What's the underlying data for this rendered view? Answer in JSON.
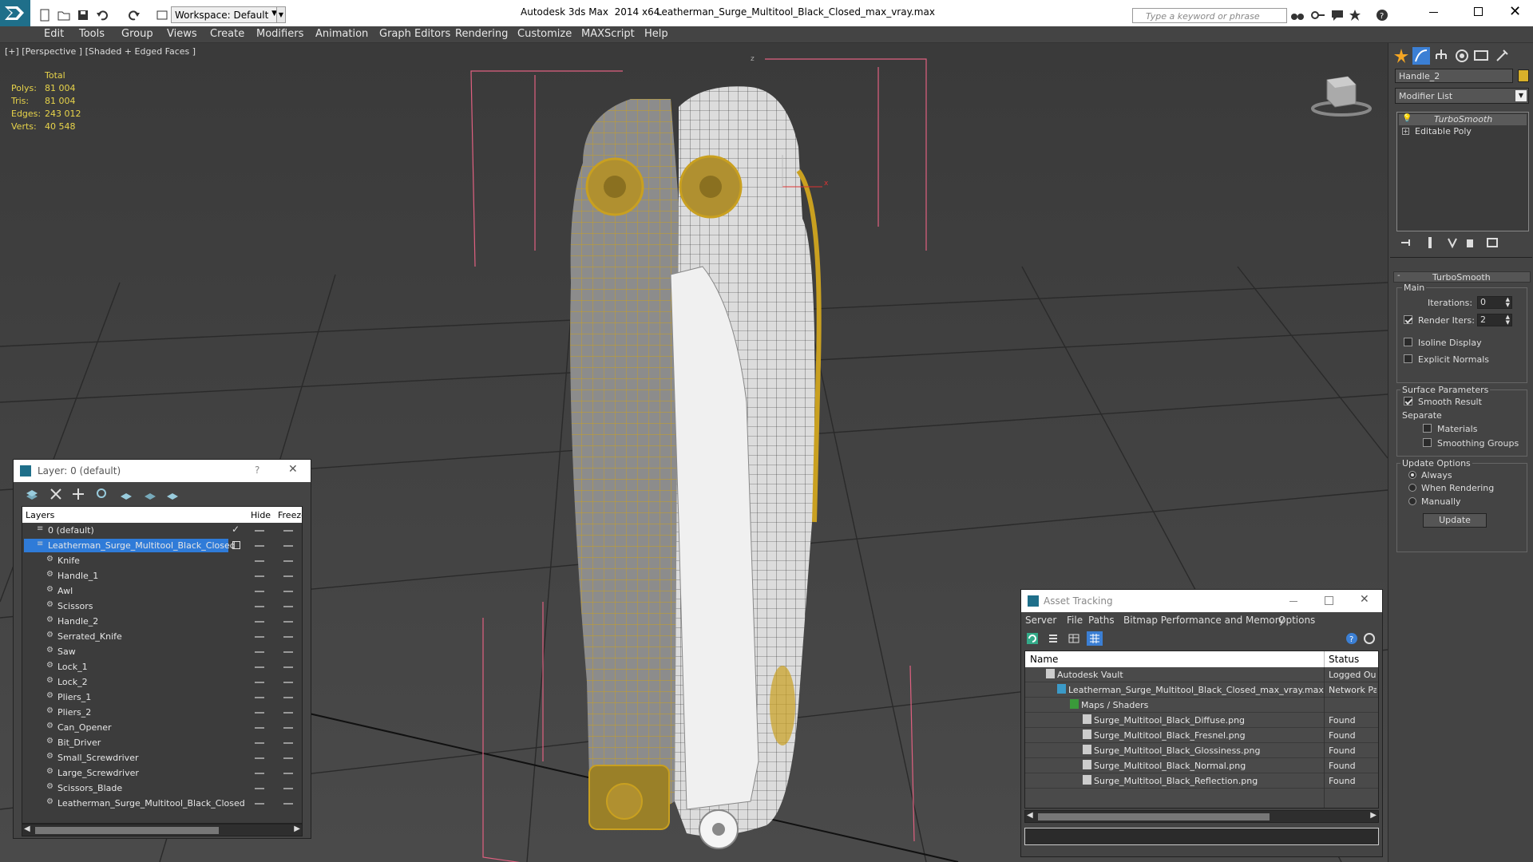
{
  "titlebar": {
    "app_title": "Autodesk 3ds Max  2014 x64",
    "file_title": "Leatherman_Surge_Multitool_Black_Closed_max_vray.max",
    "workspace": "Workspace: Default",
    "search_placeholder": "Type a keyword or phrase"
  },
  "menu": [
    "Edit",
    "Tools",
    "Group",
    "Views",
    "Create",
    "Modifiers",
    "Animation",
    "Graph Editors",
    "Rendering",
    "Customize",
    "MAXScript",
    "Help"
  ],
  "viewport": {
    "label": "[+] [Perspective ] [Shaded + Edged Faces ]",
    "stats": {
      "header": "Total",
      "polys_label": "Polys:",
      "polys": "81 004",
      "tris_label": "Tris:",
      "tris": "81 004",
      "edges_label": "Edges:",
      "edges": "243 012",
      "verts_label": "Verts:",
      "verts": "40 548"
    },
    "gizmo_x": "x",
    "gizmo_z": "z"
  },
  "cmdpanel": {
    "object_name": "Handle_2",
    "object_color": "#d8b02a",
    "modifier_list": "Modifier List",
    "stack": [
      "TurboSmooth",
      "Editable Poly"
    ],
    "rollout_title": "TurboSmooth",
    "main_group": "Main",
    "iterations_label": "Iterations:",
    "iterations": "0",
    "render_iters_label": "Render Iters:",
    "render_iters": "2",
    "isoline": "Isoline Display",
    "explicit": "Explicit Normals",
    "surface_group": "Surface Parameters",
    "smooth_result": "Smooth Result",
    "separate": "Separate",
    "materials": "Materials",
    "smoothing_groups": "Smoothing Groups",
    "update_group": "Update Options",
    "always": "Always",
    "when_rendering": "When Rendering",
    "manually": "Manually",
    "update_button": "Update"
  },
  "layers": {
    "title": "Layer: 0 (default)",
    "help": "?",
    "col_layers": "Layers",
    "col_hide": "Hide",
    "col_freeze": "Freeze",
    "rows": [
      "0 (default)",
      "Leatherman_Surge_Multitool_Black_Closed",
      "Knife",
      "Handle_1",
      "Awl",
      "Scissors",
      "Handle_2",
      "Serrated_Knife",
      "Saw",
      "Lock_1",
      "Lock_2",
      "Pliers_1",
      "Pliers_2",
      "Can_Opener",
      "Bit_Driver",
      "Small_Screwdriver",
      "Large_Screwdriver",
      "Scissors_Blade",
      "Leatherman_Surge_Multitool_Black_Closed"
    ]
  },
  "assets": {
    "title": "Asset Tracking",
    "menu": [
      "Server",
      "File",
      "Paths",
      "Bitmap Performance and Memory",
      "Options"
    ],
    "col_name": "Name",
    "col_status": "Status",
    "rows": [
      {
        "name": "Autodesk Vault",
        "status": "Logged Ou"
      },
      {
        "name": "Leatherman_Surge_Multitool_Black_Closed_max_vray.max",
        "status": "Network Pa"
      },
      {
        "name": "Maps / Shaders",
        "status": ""
      },
      {
        "name": "Surge_Multitool_Black_Diffuse.png",
        "status": "Found"
      },
      {
        "name": "Surge_Multitool_Black_Fresnel.png",
        "status": "Found"
      },
      {
        "name": "Surge_Multitool_Black_Glossiness.png",
        "status": "Found"
      },
      {
        "name": "Surge_Multitool_Black_Normal.png",
        "status": "Found"
      },
      {
        "name": "Surge_Multitool_Black_Reflection.png",
        "status": "Found"
      }
    ]
  }
}
